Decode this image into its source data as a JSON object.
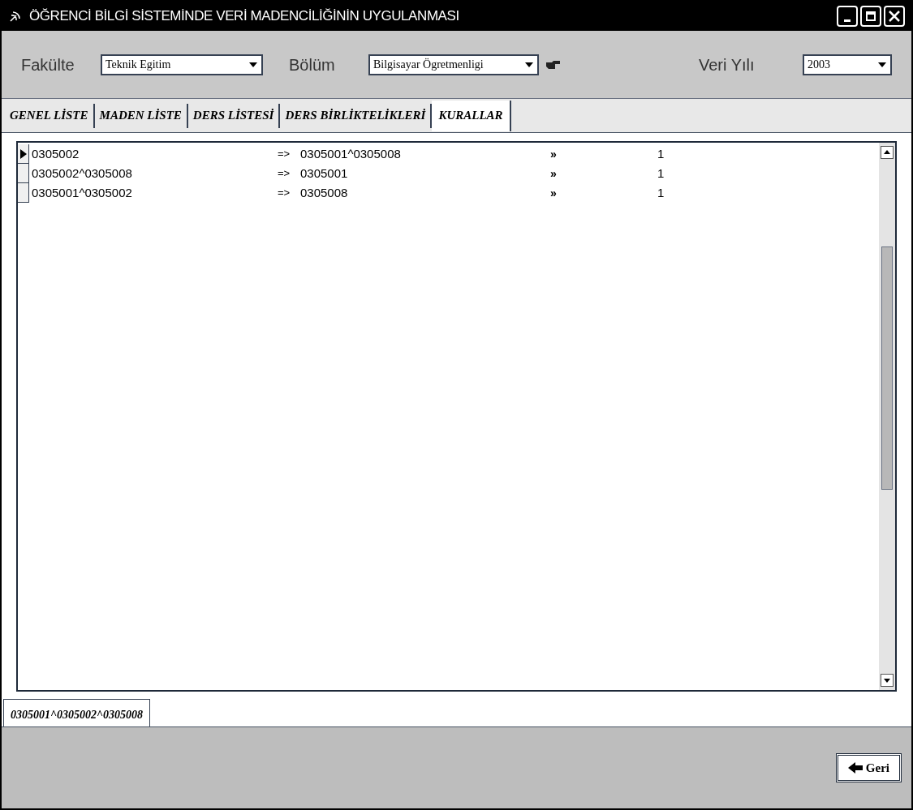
{
  "window": {
    "title": "ÖĞRENCİ BİLGİ SİSTEMİNDE VERİ MADENCİLİĞİNİN UYGULANMASI"
  },
  "filters": [
    {
      "label": "Fakülte",
      "value": "Teknik Egitim",
      "pointer": false
    },
    {
      "label": "Bölüm",
      "value": "Bilgisayar Ögretmenligi",
      "pointer": true
    },
    {
      "label": "Veri Yılı",
      "value": "2003",
      "pointer": false
    }
  ],
  "tabs": [
    {
      "label": "GENEL LİSTE",
      "selected": false
    },
    {
      "label": "MADEN LİSTE",
      "selected": false
    },
    {
      "label": "DERS LİSTESİ",
      "selected": false
    },
    {
      "label": "DERS BİRLİKTELİKLERİ",
      "selected": false
    },
    {
      "label": "KURALLAR",
      "selected": true
    }
  ],
  "rules": [
    {
      "antecedent": "0305002",
      "arrow": "=>",
      "consequent": "0305001^0305008",
      "mark": "»",
      "count": "1",
      "selected": true
    },
    {
      "antecedent": "0305002^0305008",
      "arrow": "=>",
      "consequent": "0305001",
      "mark": "»",
      "count": "1",
      "selected": false
    },
    {
      "antecedent": "0305001^0305002",
      "arrow": "=>",
      "consequent": "0305008",
      "mark": "»",
      "count": "1",
      "selected": false
    }
  ],
  "bottom_tab": {
    "label": "0305001^0305002^0305008"
  },
  "buttons": [
    {
      "label": "Geri"
    }
  ]
}
